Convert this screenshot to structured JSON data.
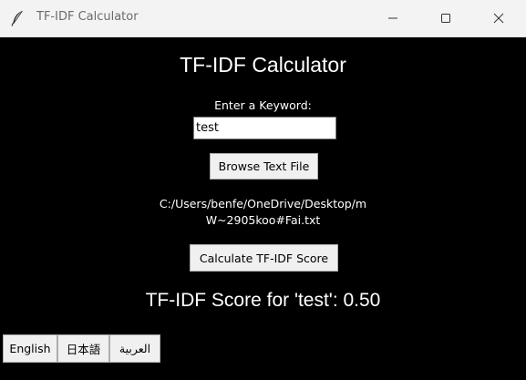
{
  "window": {
    "title": "TF-IDF Calculator",
    "icon": "feather-icon",
    "controls": [
      "minimize-icon",
      "maximize-icon",
      "close-icon"
    ]
  },
  "app": {
    "heading": "TF-IDF Calculator",
    "keyword_label": "Enter a Keyword:",
    "keyword_value": "test",
    "browse_button": "Browse Text File",
    "file_path_line1": "C:/Users/benfe/OneDrive/Desktop/m",
    "file_path_line2": "W~2905koo#Fai.txt",
    "calculate_button": "Calculate TF-IDF Score",
    "score_text": "TF-IDF Score for 'test': 0.50"
  },
  "languages": [
    {
      "label": "English"
    },
    {
      "label": "日本語"
    },
    {
      "label": "العربية"
    }
  ],
  "colors": {
    "background": "#000000",
    "text": "#ffffff",
    "button": "#f0f0f0",
    "titlebar": "#f3f3f3"
  }
}
